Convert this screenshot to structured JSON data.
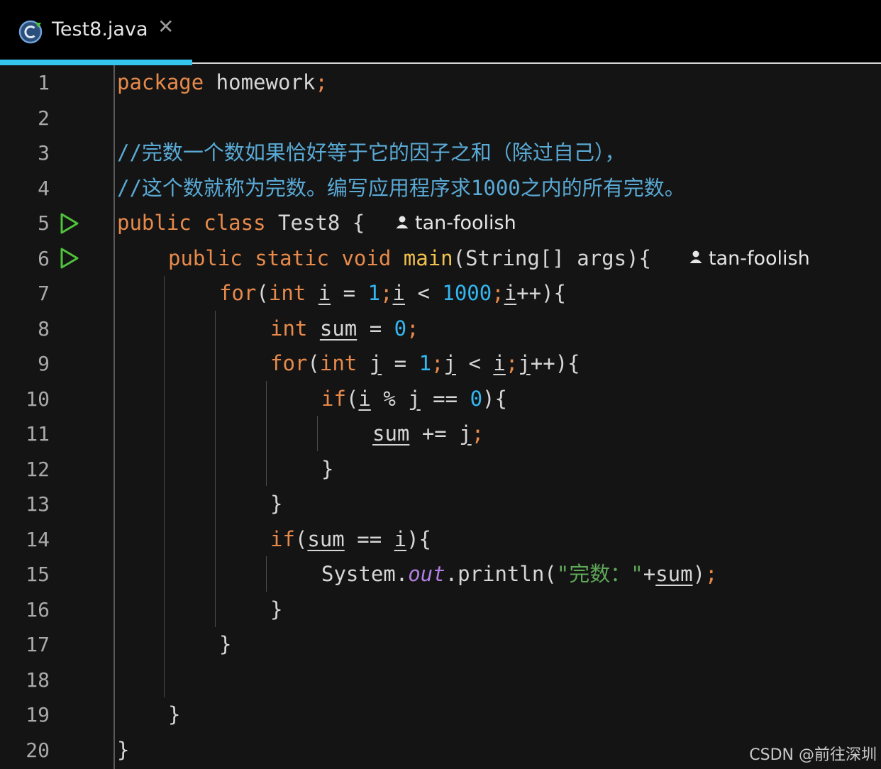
{
  "tab": {
    "title": "Test8.java",
    "close": "✕"
  },
  "author": "tan-foolish",
  "watermark": "CSDN @前往深圳",
  "colors": {
    "keyword": "#e78a4b",
    "function": "#f2c14e",
    "number": "#33b7f0",
    "comment": "#5aaad6",
    "string": "#5fa858",
    "accent": "#35c6ee",
    "run": "#4fc23b"
  },
  "line_numbers": [
    "1",
    "2",
    "3",
    "4",
    "5",
    "6",
    "7",
    "8",
    "9",
    "10",
    "11",
    "12",
    "13",
    "14",
    "15",
    "16",
    "17",
    "18",
    "19",
    "20"
  ],
  "code": {
    "l1": {
      "kw": "package",
      "rest": " homework",
      "semi": ";"
    },
    "l3": "//完数一个数如果恰好等于它的因子之和（除过自己），",
    "l4": "//这个数就称为完数。编写应用程序求1000之内的所有完数。",
    "l5": {
      "kw1": "public",
      "kw2": "class",
      "name": " Test8 {"
    },
    "l6": {
      "kw1": "public",
      "kw2": "static",
      "kw3": "void",
      "fn": "main",
      "rest": "(String[] args){"
    },
    "l7": {
      "kw1": "for",
      "p1": "(",
      "kw2": "int",
      "v1": "i",
      "t1": " = ",
      "n1": "1",
      "s1": ";",
      "v2": "i",
      "t2": " < ",
      "n2": "1000",
      "s2": ";",
      "v3": "i",
      "t3": "++){"
    },
    "l8": {
      "kw": "int",
      "v": "sum",
      "t": " = ",
      "n": "0",
      "s": ";"
    },
    "l9": {
      "kw1": "for",
      "p1": "(",
      "kw2": "int",
      "v1": "j",
      "t1": " = ",
      "n1": "1",
      "s1": ";",
      "v2": "j",
      "t2": " < ",
      "v3": "i",
      "s2": ";",
      "v4": "j",
      "t3": "++){"
    },
    "l10": {
      "kw": "if",
      "p": "(",
      "v1": "i",
      "t1": " % ",
      "v2": "j",
      "t2": " == ",
      "n": "0",
      "t3": "){"
    },
    "l11": {
      "v1": "sum",
      "t": " += ",
      "v2": "j",
      "s": ";"
    },
    "l12": "}",
    "l13": "}",
    "l14": {
      "kw": "if",
      "p": "(",
      "v1": "sum",
      "t": " == ",
      "v2": "i",
      "t2": "){"
    },
    "l15": {
      "t1": "System.",
      "field": "out",
      "t2": ".println(",
      "q1": "\"",
      "str": "完数：",
      "q2": "\"",
      "t3": "+",
      "v": "sum",
      "t4": ")",
      "s": ";"
    },
    "l16": "}",
    "l17": "}",
    "l19": "}",
    "l20": "}"
  }
}
